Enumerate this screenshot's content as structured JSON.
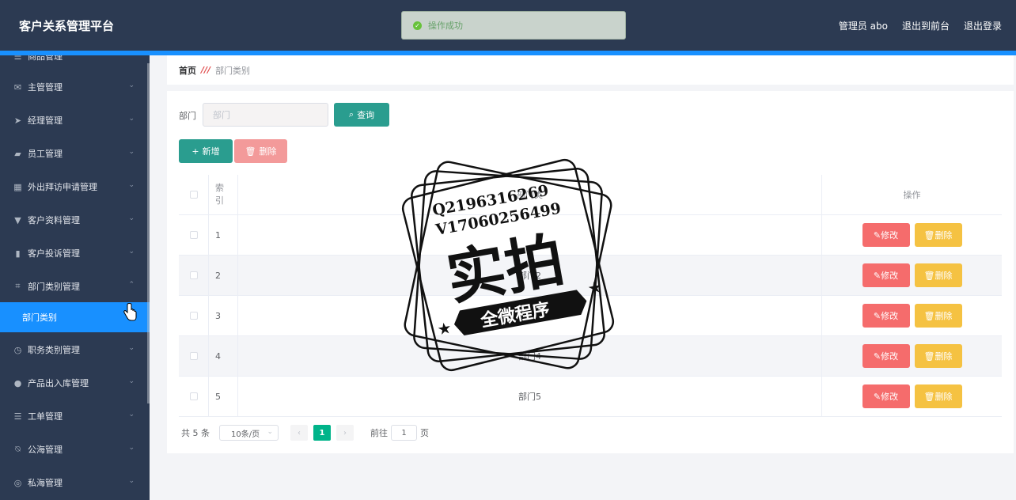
{
  "header": {
    "app_title": "客户关系管理平台",
    "toast_text": "操作成功",
    "user": "管理员 abo",
    "back_front": "退出到前台",
    "logout": "退出登录"
  },
  "sidebar": {
    "items": [
      {
        "label": "商品管理",
        "icon": "list-icon"
      },
      {
        "label": "主管管理",
        "icon": "mail-icon"
      },
      {
        "label": "经理管理",
        "icon": "send-icon"
      },
      {
        "label": "员工管理",
        "icon": "briefcase-icon"
      },
      {
        "label": "外出拜访申请管理",
        "icon": "grid-icon"
      },
      {
        "label": "客户资料管理",
        "icon": "pin-icon"
      },
      {
        "label": "客户投诉管理",
        "icon": "chart-icon"
      },
      {
        "label": "部门类别管理",
        "icon": "crop-icon"
      },
      {
        "label": "职务类别管理",
        "icon": "clock-icon"
      },
      {
        "label": "产品出入库管理",
        "icon": "user-icon"
      },
      {
        "label": "工单管理",
        "icon": "list-icon"
      },
      {
        "label": "公海管理",
        "icon": "bell-off-icon"
      },
      {
        "label": "私海管理",
        "icon": "compass-icon"
      }
    ],
    "active_sub": "部门类别"
  },
  "breadcrumb": {
    "home": "首页",
    "current": "部门类别"
  },
  "search": {
    "label": "部门",
    "placeholder": "部门",
    "query_label": "查询"
  },
  "toolbar": {
    "add_label": "新增",
    "delete_label": "删除"
  },
  "table": {
    "headers": {
      "index_1": "索",
      "index_2": "引",
      "name": "部门类",
      "ops": "操作"
    },
    "rows": [
      {
        "index": "1",
        "name": ""
      },
      {
        "index": "2",
        "name": "部门2"
      },
      {
        "index": "3",
        "name": ""
      },
      {
        "index": "4",
        "name": "部门4"
      },
      {
        "index": "5",
        "name": "部门5"
      }
    ],
    "edit_label": "修改",
    "del_label": "删除"
  },
  "pager": {
    "total": "共 5 条",
    "page_size": "10条/页",
    "current_page": "1",
    "goto_prefix": "前往",
    "goto_value": "1",
    "goto_suffix": "页"
  },
  "watermark": {
    "line1": "Q2196316269",
    "line2": "V17060256499",
    "big_text": "实拍",
    "banner": "全微程序"
  },
  "colors": {
    "header_bg": "#2c3a52",
    "accent": "#1890ff",
    "teal": "#2a9d8f",
    "edit_red": "#f56c6c",
    "del_yellow": "#f5c242"
  }
}
